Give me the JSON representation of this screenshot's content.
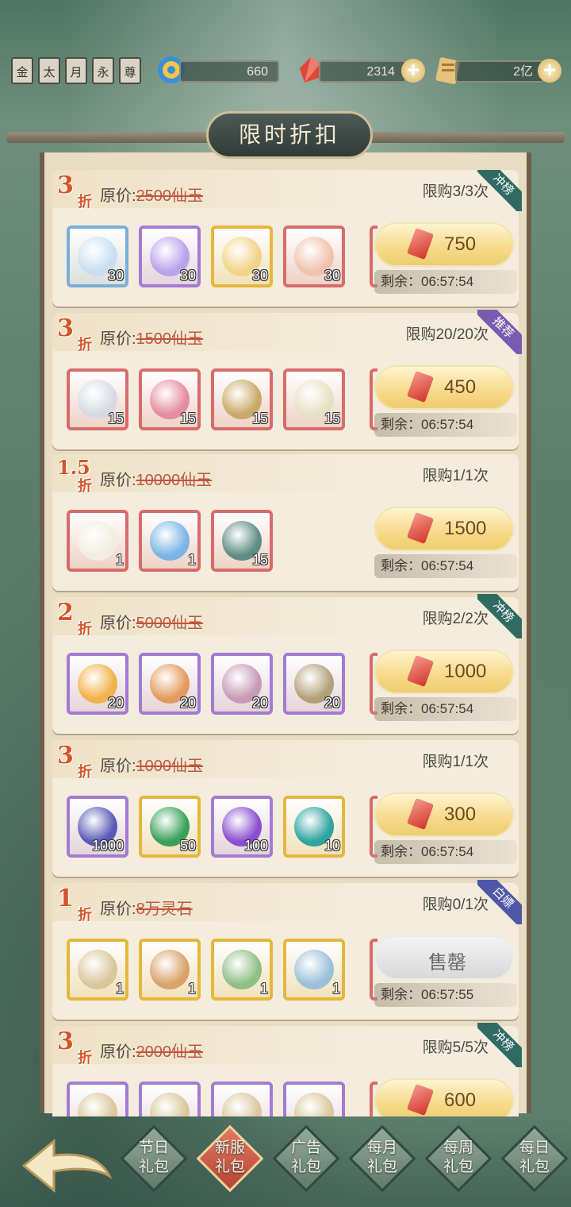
{
  "header": {
    "badges": [
      "金",
      "太",
      "月",
      "永",
      "尊"
    ],
    "jade_amount": "660",
    "gem_amount": "2314",
    "gold_amount": "2亿"
  },
  "title": "限时折扣",
  "original_price_label": "原价:",
  "packs": [
    {
      "discount": "3",
      "zhe": "折",
      "original": "2500仙玉",
      "limit": "限购3/3次",
      "ribbon": "冲榜",
      "ribbon_color": "#2f6b63",
      "price": "750",
      "remaining": "剩余：06:57:54",
      "items": [
        {
          "qty": "30",
          "frame": "#7aaed8",
          "icon": "#c9dff0"
        },
        {
          "qty": "30",
          "frame": "#a37ad4",
          "icon": "#b9a3ea"
        },
        {
          "qty": "30",
          "frame": "#e5b73b",
          "icon": "#f2d488"
        },
        {
          "qty": "30",
          "frame": "#d86b6b",
          "icon": "#f1c1ad"
        }
      ]
    },
    {
      "discount": "3",
      "zhe": "折",
      "original": "1500仙玉",
      "limit": "限购20/20次",
      "ribbon": "推荐",
      "ribbon_color": "#7a5bb0",
      "price": "450",
      "remaining": "剩余：06:57:54",
      "items": [
        {
          "qty": "15",
          "frame": "#d86b6b",
          "icon": "#d6dbe3"
        },
        {
          "qty": "15",
          "frame": "#d86b6b",
          "icon": "#e58da0"
        },
        {
          "qty": "15",
          "frame": "#d86b6b",
          "icon": "#c9a96a"
        },
        {
          "qty": "15",
          "frame": "#d86b6b",
          "icon": "#e6e1c5"
        }
      ]
    },
    {
      "discount": "1.5",
      "zhe": "折",
      "original": "10000仙玉",
      "limit": "限购1/1次",
      "ribbon": "",
      "ribbon_color": "",
      "price": "1500",
      "remaining": "剩余：06:57:54",
      "items": [
        {
          "qty": "1",
          "frame": "#d86b6b",
          "icon": "#f1ede2"
        },
        {
          "qty": "1",
          "frame": "#d86b6b",
          "icon": "#7ab5e6"
        },
        {
          "qty": "15",
          "frame": "#d86b6b",
          "icon": "#5f8c84"
        }
      ]
    },
    {
      "discount": "2",
      "zhe": "折",
      "original": "5000仙玉",
      "limit": "限购2/2次",
      "ribbon": "冲榜",
      "ribbon_color": "#2f6b63",
      "price": "1000",
      "remaining": "剩余：06:57:54",
      "items": [
        {
          "qty": "20",
          "frame": "#a37ad4",
          "icon": "#f1b249"
        },
        {
          "qty": "20",
          "frame": "#a37ad4",
          "icon": "#e39a5e"
        },
        {
          "qty": "20",
          "frame": "#a37ad4",
          "icon": "#c79ab6"
        },
        {
          "qty": "20",
          "frame": "#a37ad4",
          "icon": "#b2a07a"
        }
      ]
    },
    {
      "discount": "3",
      "zhe": "折",
      "original": "1000仙玉",
      "limit": "限购1/1次",
      "ribbon": "",
      "ribbon_color": "",
      "price": "300",
      "remaining": "剩余：06:57:54",
      "items": [
        {
          "qty": "1000",
          "frame": "#a37ad4",
          "icon": "#5a5ab8"
        },
        {
          "qty": "50",
          "frame": "#e5b73b",
          "icon": "#39a05a"
        },
        {
          "qty": "100",
          "frame": "#a37ad4",
          "icon": "#8a4ed0"
        },
        {
          "qty": "10",
          "frame": "#e5b73b",
          "icon": "#2fa3a0"
        }
      ]
    },
    {
      "discount": "1",
      "zhe": "折",
      "original": "8万灵石",
      "limit": "限购0/1次",
      "ribbon": "白嫖",
      "ribbon_color": "#4f58a8",
      "price": "售罄",
      "sold_out": true,
      "remaining": "剩余：06:57:55",
      "items": [
        {
          "qty": "1",
          "frame": "#e5b73b",
          "icon": "#d9c69a"
        },
        {
          "qty": "1",
          "frame": "#e5b73b",
          "icon": "#d9a26a"
        },
        {
          "qty": "1",
          "frame": "#e5b73b",
          "icon": "#8fbf85"
        },
        {
          "qty": "1",
          "frame": "#e5b73b",
          "icon": "#9bc0d8"
        }
      ]
    },
    {
      "discount": "3",
      "zhe": "折",
      "original": "2000仙玉",
      "limit": "限购5/5次",
      "ribbon": "冲榜",
      "ribbon_color": "#2f6b63",
      "price": "600",
      "remaining": "",
      "items": [
        {
          "qty": "",
          "frame": "#a37ad4",
          "icon": "#d9c69a"
        },
        {
          "qty": "",
          "frame": "#a37ad4",
          "icon": "#d9c69a"
        },
        {
          "qty": "",
          "frame": "#a37ad4",
          "icon": "#d9c69a"
        },
        {
          "qty": "",
          "frame": "#a37ad4",
          "icon": "#d9c69a"
        }
      ]
    }
  ],
  "tabs": [
    {
      "line1": "节日",
      "line2": "礼包",
      "active": false
    },
    {
      "line1": "新服",
      "line2": "礼包",
      "active": true
    },
    {
      "line1": "广告",
      "line2": "礼包",
      "active": false
    },
    {
      "line1": "每月",
      "line2": "礼包",
      "active": false
    },
    {
      "line1": "每周",
      "line2": "礼包",
      "active": false
    },
    {
      "line1": "每日",
      "line2": "礼包",
      "active": false
    }
  ]
}
